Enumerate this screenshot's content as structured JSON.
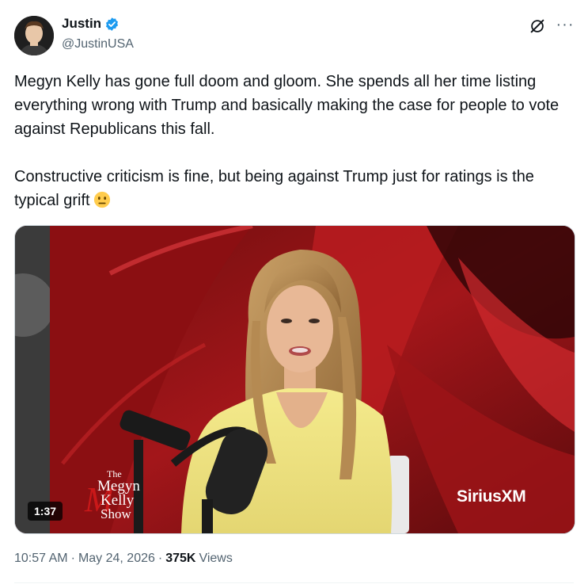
{
  "author": {
    "display_name": "Justin",
    "handle": "@JustinUSA",
    "verified": true,
    "verified_color": "#1d9bf0"
  },
  "header_actions": {
    "grok_icon": "grok-icon",
    "more_icon": "more-icon",
    "more_label": "···"
  },
  "tweet": {
    "paragraph_1": "Megyn Kelly has gone full doom and gloom. She spends all her time listing everything wrong with Trump and basically making the case for people to vote against Republicans this fall.",
    "paragraph_2": "Constructive criticism is fine, but being against Trump just for ratings is the typical grift",
    "emoji": "neutral-face-emoji"
  },
  "media": {
    "type": "video",
    "duration": "1:37",
    "watermark": "SiriusXM",
    "show_logo": {
      "the": "The",
      "megyn": "Megyn",
      "kelly": "Kelly",
      "show": "Show"
    }
  },
  "meta": {
    "time": "10:57 AM",
    "separator": "·",
    "date": "May 24, 2026",
    "views_count": "375K",
    "views_label": "Views"
  },
  "colors": {
    "text_primary": "#0f1419",
    "text_secondary": "#536471",
    "border": "#cfd9de",
    "accent": "#1d9bf0"
  }
}
